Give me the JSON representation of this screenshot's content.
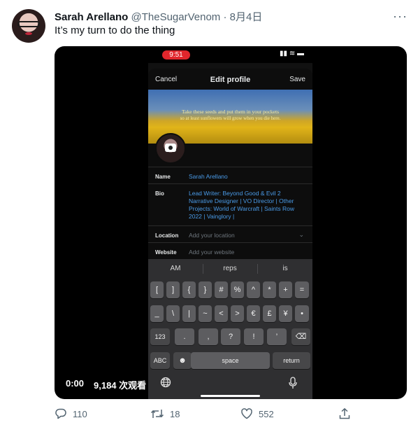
{
  "tweet": {
    "author_name": "Sarah Arellano",
    "handle": "@TheSugarVenom",
    "separator": "·",
    "date": "8月4日",
    "more_label": "···",
    "text": "It’s my turn to do the thing"
  },
  "video": {
    "current_time": "0:00",
    "views": "9,184 次观看",
    "phone": {
      "status_time": "9:51",
      "status_icons": "▮▮ ≋ ▬",
      "header": {
        "cancel": "Cancel",
        "title": "Edit profile",
        "save": "Save"
      },
      "banner": {
        "line1": "Take these seeds and put them in your pockets",
        "line2": "so at least sunflowers will grow when you die here."
      },
      "fields": {
        "name_label": "Name",
        "name_value": "Sarah Arellano",
        "bio_label": "Bio",
        "bio_lines": [
          "Lead Writer: Beyond Good & Evil 2",
          "Narrative Designer | VO Director | Other",
          "Projects: World of Warcraft | Saints Row",
          "2022 | Vainglory |"
        ],
        "location_label": "Location",
        "location_placeholder": "Add your location",
        "website_label": "Website",
        "website_placeholder": "Add your website"
      },
      "keyboard": {
        "suggestions": [
          "AM",
          "reps",
          "is"
        ],
        "row1": [
          "[",
          "]",
          "{",
          "}",
          "#",
          "%",
          "^",
          "*",
          "+",
          "="
        ],
        "row2": [
          "_",
          "\\",
          "|",
          "~",
          "<",
          ">",
          "€",
          "£",
          "¥",
          "•"
        ],
        "row3_left": "123",
        "row3": [
          ".",
          ",",
          "?",
          "!",
          "’"
        ],
        "row3_delete": "⌫",
        "abc": "ABC",
        "emoji": "☻",
        "space": "space",
        "return": "return",
        "globe": "🌐",
        "mic": "🎤"
      }
    }
  },
  "actions": {
    "replies": "110",
    "retweets": "18",
    "likes": "552"
  },
  "colors": {
    "accent": "#1d9bf0",
    "muted": "#536471",
    "status_pill": "#e0262c"
  }
}
